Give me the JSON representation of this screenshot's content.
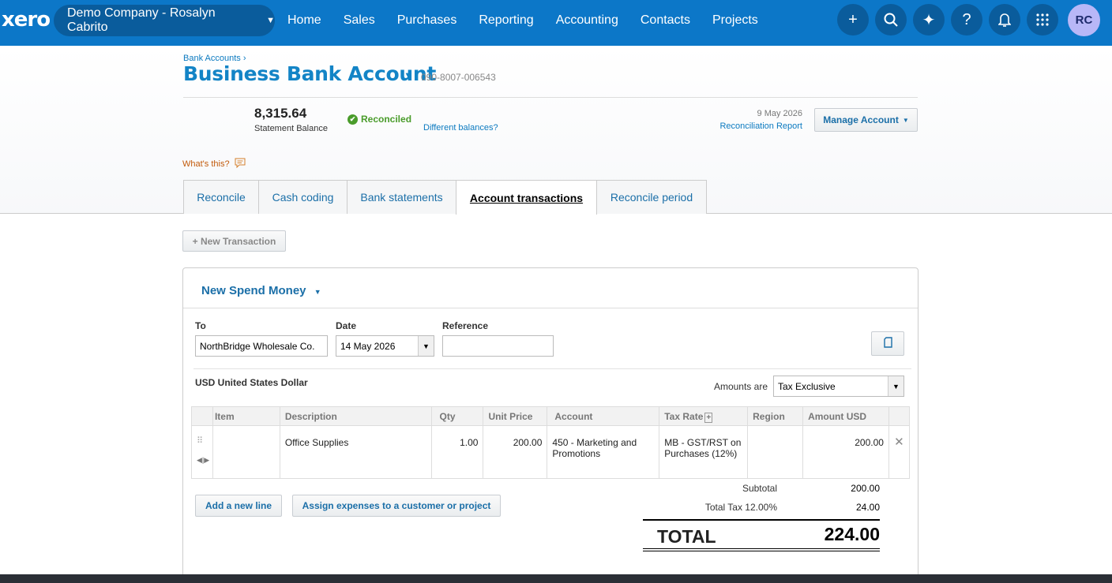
{
  "topbar": {
    "logo": "xero",
    "org": "Demo Company - Rosalyn Cabrito",
    "nav": [
      "Home",
      "Sales",
      "Purchases",
      "Reporting",
      "Accounting",
      "Contacts",
      "Projects"
    ],
    "icons": [
      "plus-icon",
      "search-icon",
      "sparkle-icon",
      "help-icon",
      "bell-icon",
      "apps-grid-icon"
    ],
    "avatar": "RC"
  },
  "account": {
    "breadcrumb": "Bank Accounts ›",
    "title": "Business Bank Account",
    "number": "090-8007-006543",
    "balance": "8,315.64",
    "balance_label": "Statement Balance",
    "status": "Reconciled",
    "different_balances": "Different balances?",
    "report_date": "9 May 2026",
    "report_link": "Reconciliation Report",
    "manage_button": "Manage Account"
  },
  "whats_this": "What's this?",
  "tabs": [
    "Reconcile",
    "Cash coding",
    "Bank statements",
    "Account transactions",
    "Reconcile period"
  ],
  "active_tab": "Account transactions",
  "new_transaction": "+ New Transaction",
  "form": {
    "heading": "New Spend Money",
    "to_label": "To",
    "to_value": "NorthBridge Wholesale Co.",
    "date_label": "Date",
    "date_value": "14 May 2026",
    "reference_label": "Reference",
    "reference_value": "",
    "currency": "USD United States Dollar",
    "amounts_are_label": "Amounts are",
    "amounts_are_value": "Tax Exclusive"
  },
  "table": {
    "headers": [
      "Item",
      "Description",
      "Qty",
      "Unit Price",
      "Account",
      "Tax Rate",
      "Region",
      "Amount USD"
    ],
    "row": {
      "item": "",
      "description": "Office Supplies",
      "qty": "1.00",
      "unit_price": "200.00",
      "account": "450 - Marketing and Promotions",
      "tax_rate": "MB - GST/RST on Purchases (12%)",
      "region": "",
      "amount": "200.00"
    }
  },
  "buttons": {
    "add_line": "Add a new line",
    "assign": "Assign expenses to a customer or project"
  },
  "totals": {
    "subtotal_label": "Subtotal",
    "subtotal": "200.00",
    "tax_label": "Total Tax 12.00%",
    "tax": "24.00",
    "total_label": "TOTAL",
    "total": "224.00"
  }
}
